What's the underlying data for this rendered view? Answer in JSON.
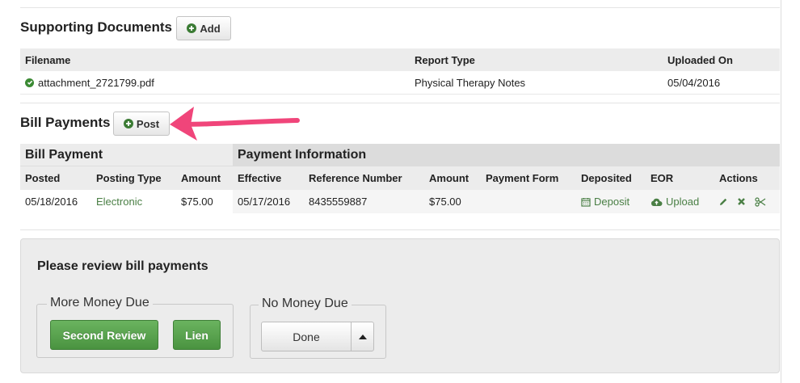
{
  "supporting_documents": {
    "title": "Supporting Documents",
    "add_label": "Add",
    "columns": [
      "Filename",
      "Report Type",
      "Uploaded On"
    ],
    "rows": [
      {
        "filename": "attachment_2721799.pdf",
        "report_type": "Physical Therapy Notes",
        "uploaded_on": "05/04/2016"
      }
    ]
  },
  "bill_payments": {
    "title": "Bill Payments",
    "post_label": "Post",
    "group_left": "Bill Payment",
    "group_right": "Payment Information",
    "columns": [
      "Posted",
      "Posting Type",
      "Amount",
      "Effective",
      "Reference Number",
      "Amount",
      "Payment Form",
      "Deposited",
      "EOR",
      "Actions"
    ],
    "rows": [
      {
        "posted": "05/18/2016",
        "posting_type": "Electronic",
        "amount": "$75.00",
        "effective": "05/17/2016",
        "reference_number": "8435559887",
        "payment_amount": "$75.00",
        "payment_form": "",
        "deposited": "Deposit",
        "eor": "Upload"
      }
    ]
  },
  "review": {
    "title": "Please review bill payments",
    "more_money_due": "More Money Due",
    "second_review": "Second Review",
    "lien": "Lien",
    "no_money_due": "No Money Due",
    "done": "Done"
  },
  "colors": {
    "accent_green": "#4a9340",
    "link_green": "#4a7f45",
    "annotation_pink": "#f0457a"
  },
  "icons": [
    "plus-circle-icon",
    "check-circle-icon",
    "calendar-icon",
    "cloud-upload-icon",
    "pencil-icon",
    "delete-x-icon",
    "scissors-icon",
    "caret-up-icon",
    "annotation-arrow-icon"
  ]
}
